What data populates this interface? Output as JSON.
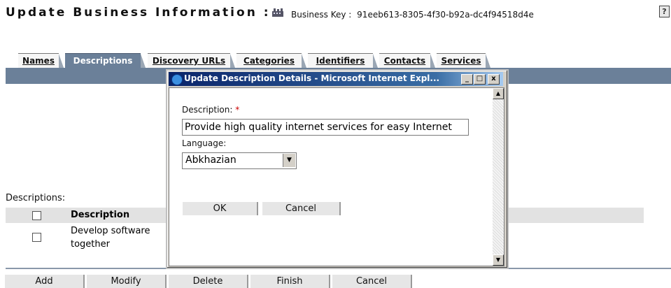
{
  "header": {
    "title": "Update Business Information :",
    "business_key_label": "Business Key :",
    "business_key_value": "91eeb613-8305-4f30-b92a-dc4f94518d4e"
  },
  "help_label": "?",
  "tabs": [
    {
      "label": "Names",
      "active": false
    },
    {
      "label": "Descriptions",
      "active": true
    },
    {
      "label": "Discovery URLs",
      "active": false
    },
    {
      "label": "Categories",
      "active": false
    },
    {
      "label": "Identifiers",
      "active": false
    },
    {
      "label": "Contacts",
      "active": false
    },
    {
      "label": "Services",
      "active": false
    }
  ],
  "descriptions": {
    "section_label": "Descriptions:",
    "column_header": "Description",
    "rows": [
      {
        "text": "Develop software together",
        "checked": false
      }
    ]
  },
  "actions": [
    "Add",
    "Modify",
    "Delete",
    "Finish",
    "Cancel"
  ],
  "dialog": {
    "title": "Update Description Details - Microsoft Internet Expl...",
    "window_buttons": [
      "_",
      "□",
      "x"
    ],
    "description_label": "Description:",
    "required_mark": "*",
    "description_value": "Provide high quality internet services for easy Internet",
    "language_label": "Language:",
    "language_value": "Abkhazian",
    "ok_label": "OK",
    "cancel_label": "Cancel"
  },
  "icons": {
    "title_icon": "business-entity-icon",
    "dialog_icon": "internet-explorer-icon"
  },
  "colors": {
    "tab_active": "#6b8099",
    "dialog_titlebar": "#0a246a",
    "required": "#cc0000"
  }
}
